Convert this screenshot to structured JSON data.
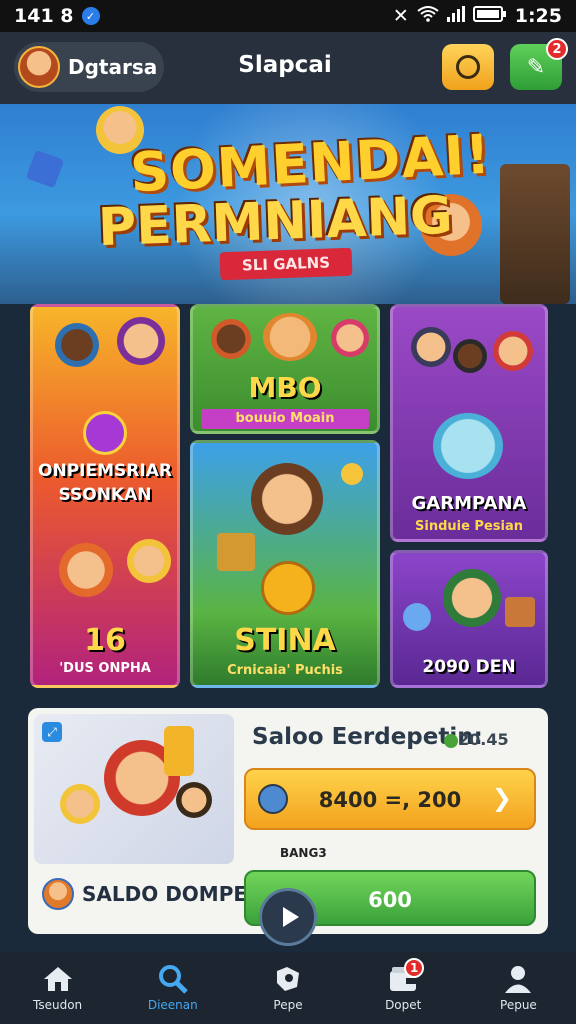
{
  "status_bar": {
    "time_left": "141 8",
    "time_right": "1:25"
  },
  "header": {
    "user_name": "Dgtarsa",
    "title": "Slapcai",
    "message_count": "2"
  },
  "hero": {
    "title_line1": "SOMENDAI!",
    "title_line2": "PERMNIANG",
    "ribbon": "SLI GALNS"
  },
  "games": [
    {
      "title": "ONPIEMSRIAR SSONKAN",
      "count": "16",
      "sub": "'DUS ONPHA"
    },
    {
      "title": "MBO",
      "sub": "bouuio Moain"
    },
    {
      "title": "GARMPANA",
      "sub": "Sinduie Pesian"
    },
    {
      "title": "STINA",
      "sub": "Crnicaia' Puchis"
    },
    {
      "title": "2090 DEN"
    }
  ],
  "wallet": {
    "title": "Saloo Eerdepetin:",
    "title_value": "20.45",
    "amount": "8400 =, 200",
    "small_label": "BANG3",
    "wallet_label": "SALDO DOMPET",
    "green_value": "600"
  },
  "nav": [
    {
      "label": "Tseudon",
      "icon": "home-icon"
    },
    {
      "label": "Dieenan",
      "icon": "search-icon"
    },
    {
      "label": "Pepe",
      "icon": "puzzle-icon"
    },
    {
      "label": "Dopet",
      "icon": "wallet-icon",
      "badge": "1"
    },
    {
      "label": "Pepue",
      "icon": "person-icon"
    }
  ],
  "colors": {
    "accent": "#46a8f0",
    "gold": "#f3a21e",
    "green": "#3aa23b",
    "badge": "#e42b2b"
  }
}
